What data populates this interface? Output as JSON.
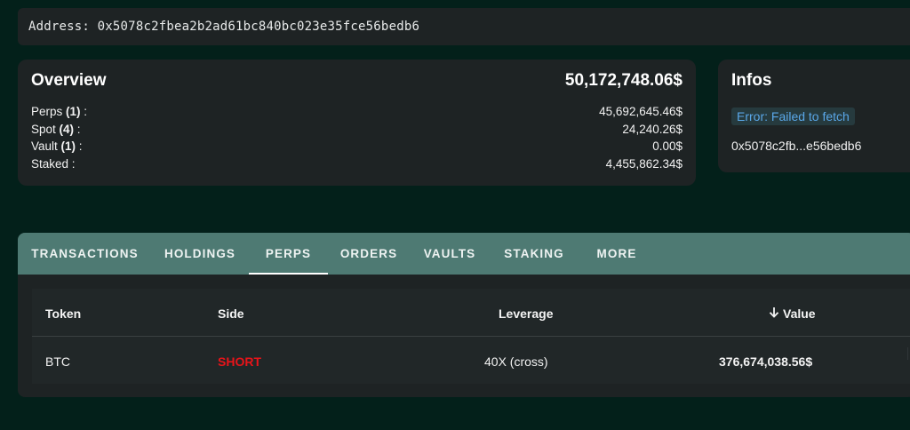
{
  "address": {
    "label": "Address:",
    "value": "0x5078c2fbea2b2ad61bc840bc023e35fce56bedb6"
  },
  "overview": {
    "title": "Overview",
    "total": "50,172,748.06$",
    "rows": [
      {
        "label": "Perps",
        "count": "(1)",
        "suffix": " :",
        "value": "45,692,645.46$"
      },
      {
        "label": "Spot",
        "count": "(4)",
        "suffix": " :",
        "value": "24,240.26$"
      },
      {
        "label": "Vault",
        "count": "(1)",
        "suffix": " :",
        "value": "0.00$"
      },
      {
        "label": "Staked",
        "count": "",
        "suffix": " :",
        "value": "4,455,862.34$"
      }
    ]
  },
  "infos": {
    "title": "Infos",
    "error": "Error: Failed to fetch",
    "short_address": "0x5078c2fb...e56bedb6"
  },
  "tabs": [
    {
      "label": "TRANSACTIONS",
      "active": false
    },
    {
      "label": "HOLDINGS",
      "active": false
    },
    {
      "label": "PERPS",
      "active": true
    },
    {
      "label": "ORDERS",
      "active": false
    },
    {
      "label": "VAULTS",
      "active": false
    },
    {
      "label": "STAKING",
      "active": false
    },
    {
      "label": "MORE",
      "active": false
    }
  ],
  "table": {
    "headers": {
      "token": "Token",
      "side": "Side",
      "leverage": "Leverage",
      "value": "Value"
    },
    "sort_icon": "arrow-down-icon",
    "rows": [
      {
        "token": "BTC",
        "side": "SHORT",
        "leverage": "40X (cross)",
        "value": "376,674,038.56$"
      }
    ]
  },
  "colors": {
    "background": "#03201a",
    "card": "#1e2324",
    "tab_bar": "#4e7a73",
    "short": "#e8141a",
    "error_text": "#5aa7e8"
  }
}
